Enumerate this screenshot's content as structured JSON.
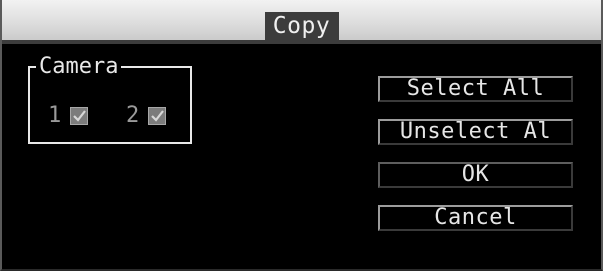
{
  "dialog": {
    "title": "Copy"
  },
  "camera_group": {
    "legend": "Camera",
    "cameras": [
      {
        "number": "1",
        "checked": true
      },
      {
        "number": "2",
        "checked": true
      }
    ]
  },
  "buttons": {
    "select_all": "Select All",
    "unselect_all": "Unselect Al",
    "ok": "OK",
    "cancel": "Cancel"
  },
  "colors": {
    "background": "#000000",
    "titlebar": "#dcdcdc",
    "text": "#e6e6e6",
    "checkbox_label": "#9a9a9a"
  },
  "icons": {
    "checkbox": "checkmark-icon"
  }
}
